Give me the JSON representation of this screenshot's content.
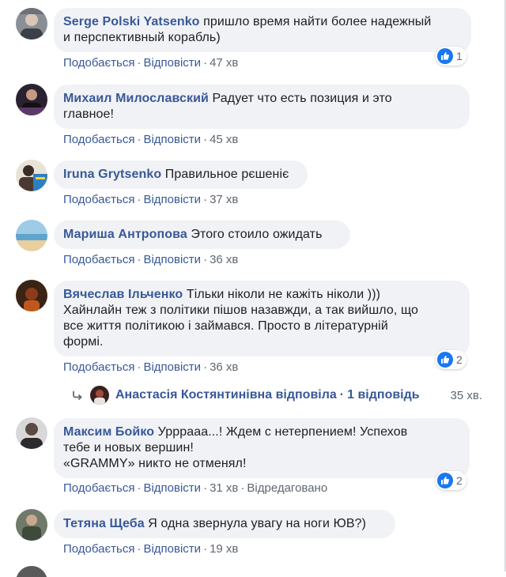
{
  "actions_labels": {
    "like": "Подобається",
    "reply": "Відповісти",
    "sep": "·",
    "edited": "Відредаговано"
  },
  "colors": {
    "link": "#385898",
    "bubble": "#f0f2f5",
    "meta": "#606770",
    "like_blue": "#1877f2"
  },
  "comments": [
    {
      "author": "Serge Polski Yatsenko",
      "lines": [
        "пришло время найти более надежный",
        "и перспективный корабль)"
      ],
      "time": "47 хв",
      "reactions": "1",
      "reaction_icon": "like-icon"
    },
    {
      "author": "Михаил Милославский",
      "lines": [
        "Радует что есть позиция и это",
        "главное!"
      ],
      "time": "45 хв"
    },
    {
      "author": "Iruna Grytsenko",
      "lines": [
        "Правильное рєшенiє"
      ],
      "time": "37 хв"
    },
    {
      "author": "Мариша Антропова",
      "lines": [
        "Этого стоило ожидать"
      ],
      "time": "36 хв"
    },
    {
      "author": "Вячеслав Ільченко",
      "lines": [
        "Тільки ніколи не кажіть ніколи )))",
        "Хайнлайн теж з політики пішов назавжди, а так вийшло, що",
        "все життя політикою і займався. Просто в літературній",
        "формі."
      ],
      "time": "36 хв",
      "reactions": "2",
      "reaction_icon": "like-icon",
      "reply_summary": {
        "name": "Анастасія Костянтинівна",
        "text": "відповіла",
        "count": "1 відповідь",
        "time": "35 хв."
      }
    },
    {
      "author": "Максим Бойко",
      "lines": [
        "Урррааа...! Ждем с нетерпением! Успехов",
        "тебе и новых вершин!",
        "«GRAMMY» никто не отменял!"
      ],
      "time": "31 хв",
      "edited": true,
      "reactions": "2",
      "reaction_icon": "like-icon"
    },
    {
      "author": "Тетяна Щеба",
      "lines": [
        "Я одна звернула увагу на ноги ЮВ?)"
      ],
      "time": "19 хв"
    }
  ]
}
